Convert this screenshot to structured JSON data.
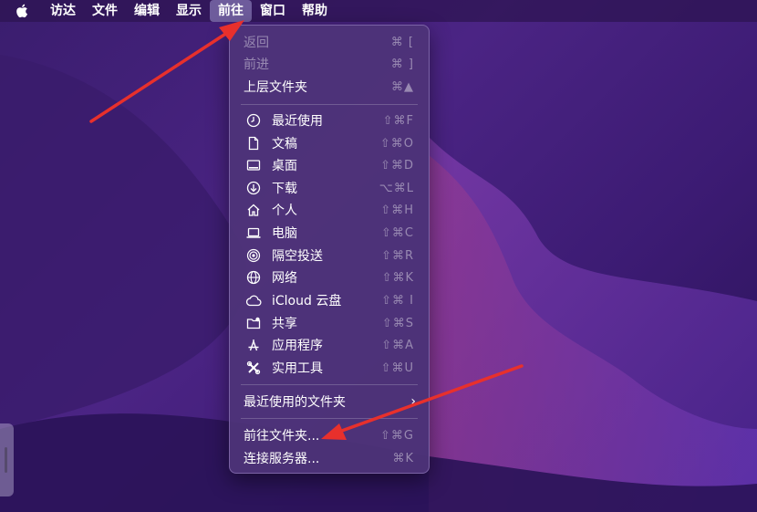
{
  "menubar": {
    "items": [
      "访达",
      "文件",
      "编辑",
      "显示",
      "前往",
      "窗口",
      "帮助"
    ]
  },
  "go_menu": {
    "back": {
      "label": "返回",
      "shortcut": "⌘ ["
    },
    "forward": {
      "label": "前进",
      "shortcut": "⌘ ]"
    },
    "enclosing": {
      "label": "上层文件夹",
      "shortcut": "⌘▲"
    },
    "places": [
      {
        "label": "最近使用",
        "shortcut": "⇧⌘F",
        "icon": "clock-icon"
      },
      {
        "label": "文稿",
        "shortcut": "⇧⌘O",
        "icon": "document-icon"
      },
      {
        "label": "桌面",
        "shortcut": "⇧⌘D",
        "icon": "desktop-icon"
      },
      {
        "label": "下载",
        "shortcut": "⌥⌘L",
        "icon": "download-icon"
      },
      {
        "label": "个人",
        "shortcut": "⇧⌘H",
        "icon": "home-icon"
      },
      {
        "label": "电脑",
        "shortcut": "⇧⌘C",
        "icon": "laptop-icon"
      },
      {
        "label": "隔空投送",
        "shortcut": "⇧⌘R",
        "icon": "airdrop-icon"
      },
      {
        "label": "网络",
        "shortcut": "⇧⌘K",
        "icon": "network-icon"
      },
      {
        "label": "iCloud 云盘",
        "shortcut": "⇧⌘ I",
        "icon": "cloud-icon"
      },
      {
        "label": "共享",
        "shortcut": "⇧⌘S",
        "icon": "shared-folder-icon"
      },
      {
        "label": "应用程序",
        "shortcut": "⇧⌘A",
        "icon": "applications-icon"
      },
      {
        "label": "实用工具",
        "shortcut": "⇧⌘U",
        "icon": "utilities-icon"
      }
    ],
    "recent_folders": {
      "label": "最近使用的文件夹",
      "chevron": "›"
    },
    "go_to_folder": {
      "label": "前往文件夹...",
      "shortcut": "⇧⌘G"
    },
    "connect_server": {
      "label": "连接服务器...",
      "shortcut": "⌘K"
    }
  }
}
